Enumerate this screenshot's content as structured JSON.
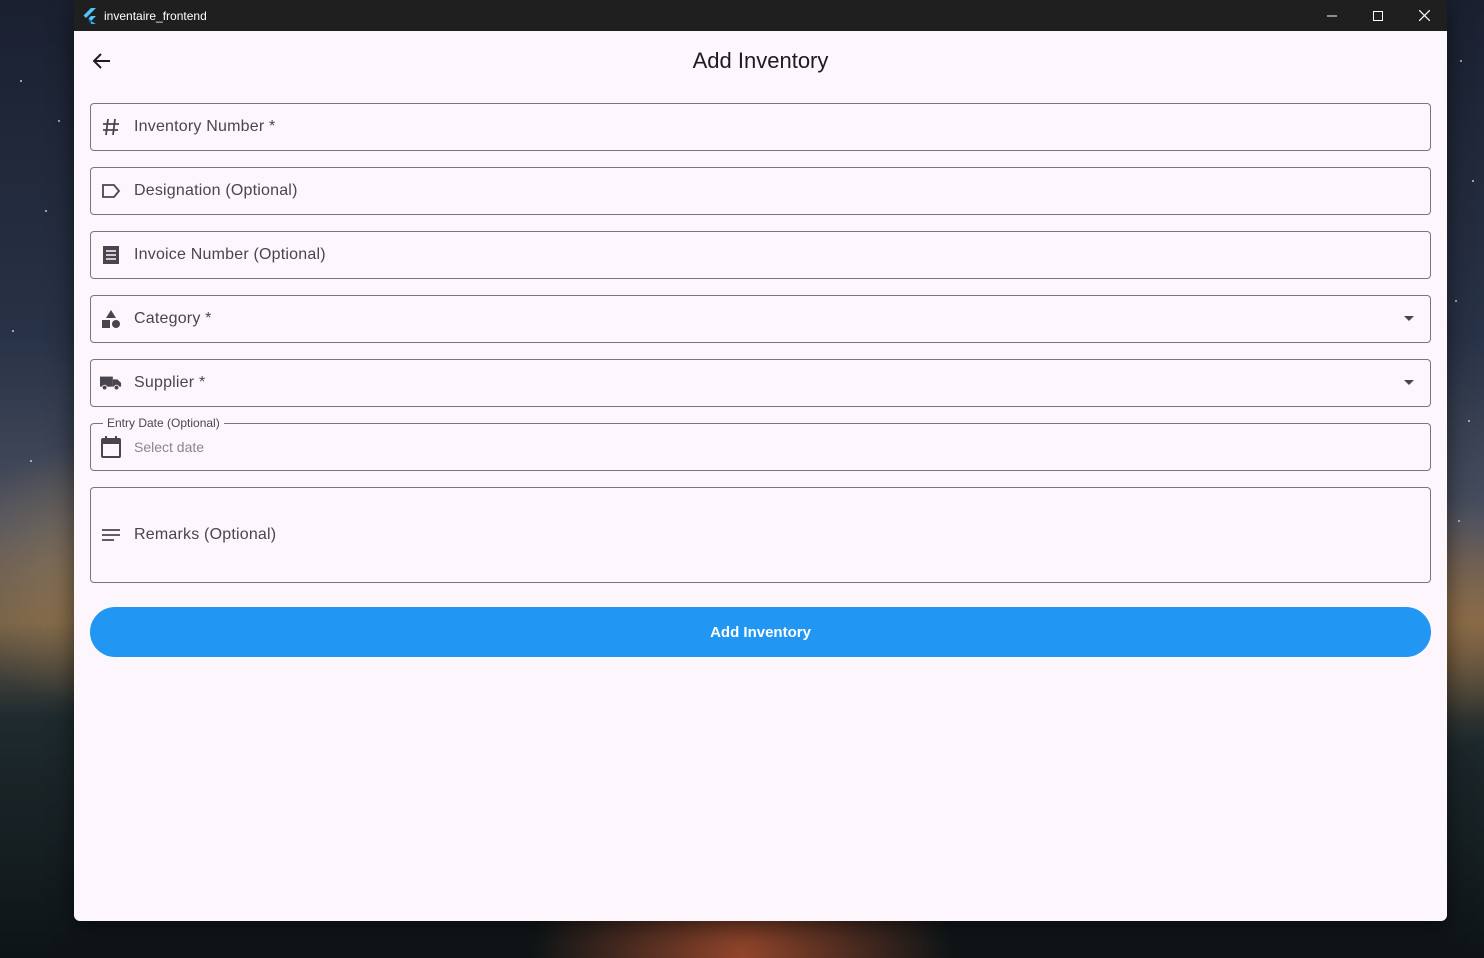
{
  "window": {
    "title": "inventaire_frontend"
  },
  "appbar": {
    "title": "Add Inventory"
  },
  "form": {
    "inventory_number": {
      "label": "Inventory Number *",
      "icon": "hash-icon"
    },
    "designation": {
      "label": "Designation (Optional)",
      "icon": "label-icon"
    },
    "invoice_number": {
      "label": "Invoice Number (Optional)",
      "icon": "receipt-icon"
    },
    "category": {
      "label": "Category *",
      "icon": "category-icon"
    },
    "supplier": {
      "label": "Supplier *",
      "icon": "truck-icon"
    },
    "entry_date": {
      "label": "Entry Date (Optional)",
      "placeholder": "Select date",
      "icon": "calendar-icon"
    },
    "remarks": {
      "label": "Remarks (Optional)",
      "icon": "notes-icon"
    },
    "submit_label": "Add Inventory"
  },
  "colors": {
    "primary": "#2196f3",
    "surface": "#fdf7fd",
    "outline": "#79747e",
    "titlebar": "#1f1f1f"
  }
}
